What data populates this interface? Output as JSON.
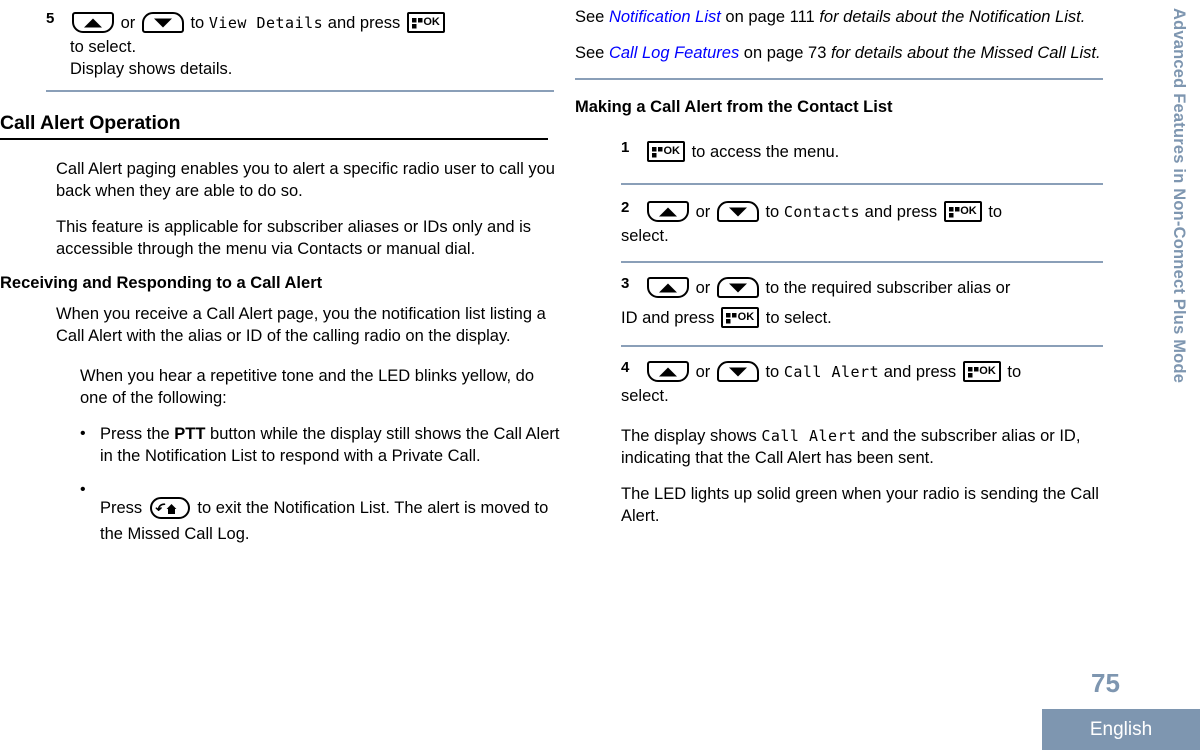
{
  "meta": {
    "page_number": "75",
    "language": "English",
    "side_tab": "Advanced Features in Non-Connect Plus Mode"
  },
  "icons": {
    "ok_label": "OK",
    "up_name": "up-arrow-key",
    "down_name": "down-arrow-key",
    "back_name": "back-home-key"
  },
  "left_column": {
    "step5": {
      "number": "5",
      "pre": "",
      "or": "or",
      "to": "to",
      "display_value": "View Details",
      "and_press": "and press",
      "tail": "to select.",
      "result": "Display shows details."
    },
    "section_title": "Call Alert Operation",
    "para1": "Call Alert paging enables you to alert a specific radio user to call you back when they are able to do so.",
    "para2": "This feature is applicable for subscriber aliases or IDs only and is accessible through the menu via Contacts or manual dial.",
    "sub_title": "Receiving and Responding to a Call Alert",
    "para3": "When you receive a Call Alert page, you the notification list listing a Call Alert with the alias or ID of the calling radio on the display.",
    "para4": "When you hear a repetitive tone and the LED blinks yellow, do one of the following:",
    "bullets": [
      {
        "marker": "•",
        "pre": "Press the ",
        "bold": "PTT",
        "post": " button while the display still shows the Call Alert in the Notification List to respond with a Private Call."
      },
      {
        "marker": "•",
        "pre": "Press",
        "post": "to exit the Notification List. The alert is moved to the Missed Call Log."
      }
    ]
  },
  "right_column": {
    "see1": {
      "see": "See ",
      "link": "Notification List",
      "mid": " on page 111 ",
      "tail": "for details about the Notification List."
    },
    "see2": {
      "see": "See ",
      "link": "Call Log Features",
      "mid": " on page 73 ",
      "tail": "for details about the Missed Call List."
    },
    "sub_title": "Making a Call Alert from the Contact List",
    "steps": [
      {
        "number": "1",
        "tail": "to access the menu."
      },
      {
        "number": "2",
        "or": "or",
        "to": "to",
        "display_value": "Contacts",
        "and_press": "and press",
        "tail": "to",
        "tail2": "select."
      },
      {
        "number": "3",
        "or": "or",
        "line1": "to the required subscriber alias or",
        "line2_pre": "ID and press",
        "line2_post": "to select."
      },
      {
        "number": "4",
        "or": "or",
        "to": "to",
        "display_value": "Call Alert",
        "and_press": "and press",
        "tail": "to",
        "tail2": "select."
      }
    ],
    "result1_pre": "The display shows ",
    "result1_lcd": "Call Alert",
    "result1_post": " and the subscriber alias or ID, indicating that the Call Alert has been sent.",
    "result2": "The LED lights up solid green when your radio is sending the Call Alert."
  }
}
